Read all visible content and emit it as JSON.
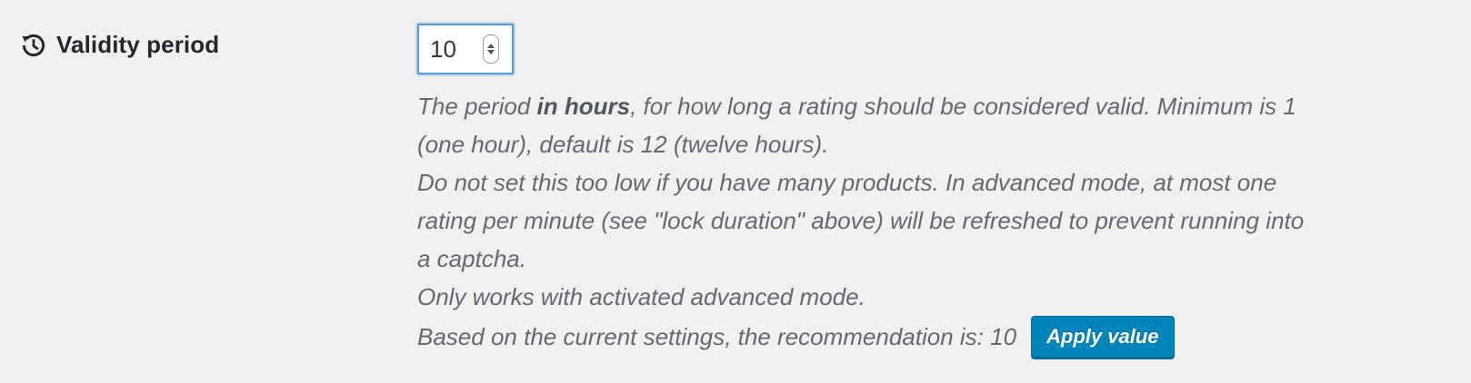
{
  "setting": {
    "label": "Validity period",
    "icon": "history-icon",
    "input": {
      "value": "10"
    },
    "description": {
      "line1_pre": "The period ",
      "line1_bold": "in hours",
      "line1_post": ", for how long a rating should be considered valid. Minimum is 1",
      "line2": "(one hour), default is 12 (twelve hours).",
      "line3": "Do not set this too low if you have many products. In advanced mode, at most one",
      "line4": "rating per minute (see \"lock duration\" above) will be refreshed to prevent running into",
      "line5": "a captcha.",
      "line6": "Only works with activated advanced mode.",
      "line7": "Based on the current settings, the recommendation is: 10"
    },
    "apply_button_label": "Apply value"
  },
  "colors": {
    "background": "#f1f1f1",
    "button": "#0085ba",
    "focus_border": "#5b9dd9",
    "text": "#23282d",
    "description_text": "#646970"
  }
}
